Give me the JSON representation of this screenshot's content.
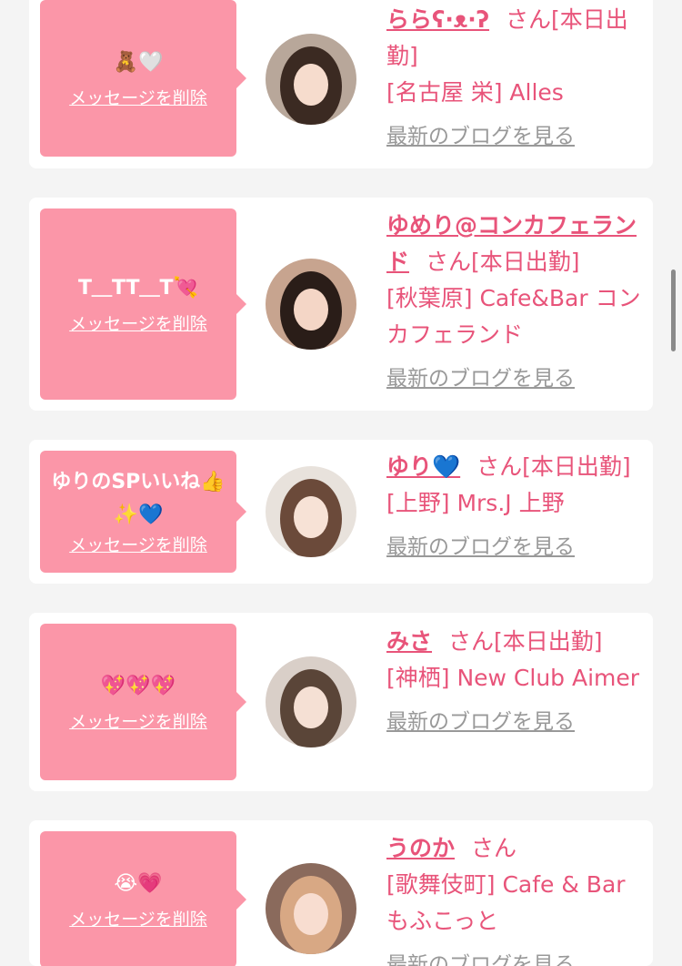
{
  "favorites": [
    {
      "message": "🧸🤍",
      "delete_label": "メッセージを削除",
      "name": "らら",
      "name_tail": "ʕ·ᴥ·ʔ",
      "honorific_status": "さん[本日出勤]",
      "location": "[名古屋 栄] Alles",
      "blog_link": "最新のブログを見る",
      "avatar_colors": {
        "bg": "#b8a79a",
        "hair": "#3b2a22",
        "face": "#f6dccd"
      }
    },
    {
      "message": "T＿TT＿T💘",
      "delete_label": "メッセージを削除",
      "name": "ゆめり@コンカフェランド",
      "honorific_status": "さん[本日出勤]",
      "location": "[秋葉原] Cafe&Bar コンカフェランド",
      "blog_link": "最新のブログを見る",
      "avatar_colors": {
        "bg": "#c7a48f",
        "hair": "#2a1d18",
        "face": "#f4d6c6"
      }
    },
    {
      "message": "ゆりのSPいいね👍✨💙",
      "delete_label": "メッセージを削除",
      "name": "ゆり💙",
      "honorific_status": "さん[本日出勤]",
      "location": "[上野] Mrs.J 上野",
      "blog_link": "最新のブログを見る",
      "avatar_colors": {
        "bg": "#e8e2dc",
        "hair": "#6b4a3a",
        "face": "#f7e2d6"
      }
    },
    {
      "message": "💖💖💖",
      "delete_label": "メッセージを削除",
      "name": "みさ",
      "honorific_status": "さん[本日出勤]",
      "location": "[神栖] New Club Aimer",
      "blog_link": "最新のブログを見る",
      "avatar_colors": {
        "bg": "#d9cfc8",
        "hair": "#5a4538",
        "face": "#f5e0d4"
      }
    },
    {
      "message": "😭💗",
      "delete_label": "メッセージを削除",
      "name": "うのか",
      "honorific_status": "さん",
      "location": "[歌舞伎町] Cafe & Bar もふこっと",
      "blog_link": "最新のブログを見る",
      "avatar_colors": {
        "bg": "#8a6a5c",
        "hair": "#d8a884",
        "face": "#f8ddd0"
      }
    }
  ],
  "colors": {
    "accent": "#e8547a",
    "bubble": "#fb96a8",
    "link_gray": "#999999",
    "background": "#f4f4f4"
  }
}
